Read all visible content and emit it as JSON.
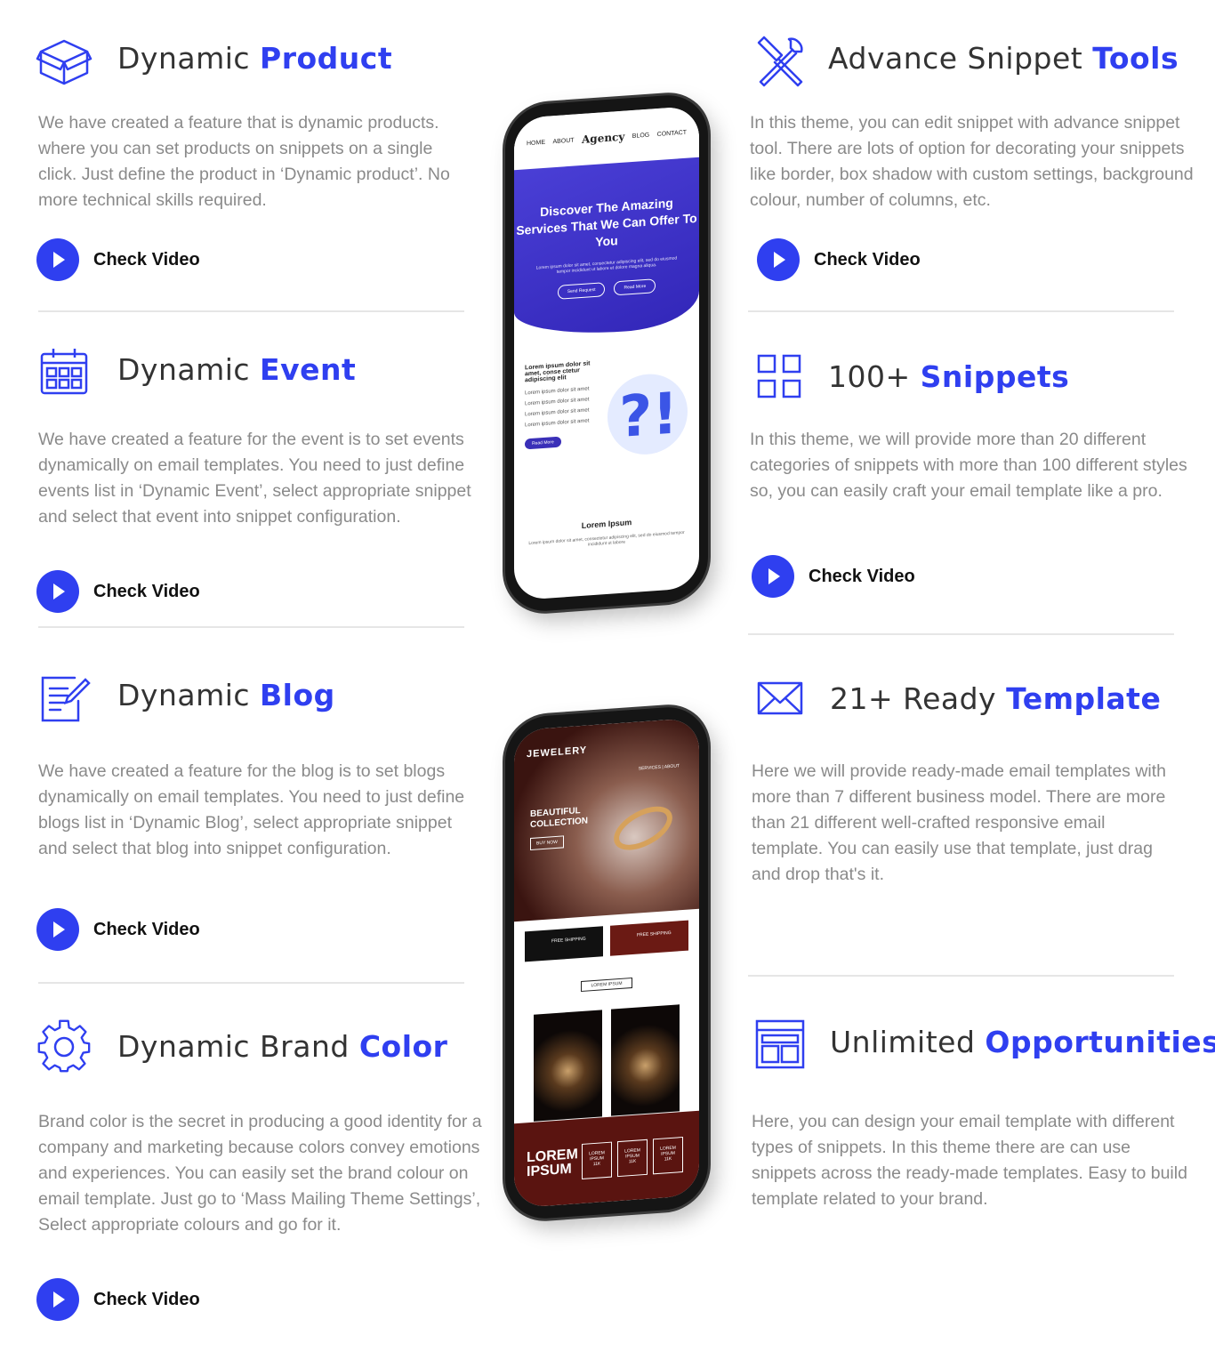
{
  "features": {
    "dynamic_product": {
      "title_plain": "Dynamic ",
      "title_highlight": "Product",
      "description": "We have created a feature that is dynamic products. where you can set products on snippets on a single click. Just define the product in ‘Dynamic product’. No more technical skills required.",
      "cta_label": "Check Video",
      "icon": "box-icon"
    },
    "dynamic_event": {
      "title_plain": "Dynamic ",
      "title_highlight": "Event",
      "description": "We have created a feature for the event is to set events dynamically on email templates. You need to just define events list in ‘Dynamic Event’, select appropriate snippet and select that event into snippet configuration.",
      "cta_label": "Check Video",
      "icon": "calendar-icon"
    },
    "dynamic_blog": {
      "title_plain": "Dynamic ",
      "title_highlight": "Blog",
      "description": "We have created a feature for the blog is to set blogs dynamically on email templates. You need to just define blogs list in ‘Dynamic Blog’, select appropriate snippet and select that blog into snippet configuration.",
      "cta_label": "Check Video",
      "icon": "edit-document-icon"
    },
    "dynamic_brand_color": {
      "title_plain": "Dynamic Brand ",
      "title_highlight": "Color",
      "description": "Brand color is the secret in producing a good identity for a company and marketing because colors convey emotions and experiences. You can easily set the brand colour on email template. Just go to ‘Mass Mailing Theme Settings’, Select appropriate colours and go for it.",
      "cta_label": "Check Video",
      "icon": "gear-icon"
    },
    "advance_snippet_tools": {
      "title_plain": "Advance Snippet ",
      "title_highlight": "Tools",
      "description": "In this theme, you can edit snippet with advance snippet tool. There are lots of option for decorating your snippets like border, box shadow with custom settings, background colour, number of columns, etc.",
      "cta_label": "Check Video",
      "icon": "tools-icon"
    },
    "snippets": {
      "title_plain": "100+ ",
      "title_highlight": "Snippets",
      "description": "In this theme, we will provide more than 20 different categories of snippets with more than 100 different styles so, you can easily craft your email template like a pro.",
      "cta_label": "Check Video",
      "icon": "grid-icon"
    },
    "ready_template": {
      "title_plain": "21+ Ready ",
      "title_highlight": "Template",
      "description": "Here we will provide ready-made email templates with more than 7 different business model. There are more than 21 different well-crafted responsive email template. You can easily use that template, just drag and drop that's it.",
      "icon": "envelope-icon"
    },
    "unlimited_opportunities": {
      "title_plain": "Unlimited ",
      "title_highlight": "Opportunities",
      "description": "Here, you can design your email template with different types of snippets. In this theme there are can use snippets across the ready-made templates. Easy to build template related to your brand.",
      "icon": "layout-icon"
    }
  },
  "phone1": {
    "nav_home": "HOME",
    "nav_about": "ABOUT",
    "brand": "Agency",
    "nav_blog": "BLOG",
    "nav_contact": "CONTACT",
    "hero_title": "Discover The Amazing Services That We Can Offer To You",
    "hero_text": "Lorem ipsum dolor sit amet, consectetur adipiscing elit, sed do eiusmod tempor incididunt ut labore et dolore magna aliqua.",
    "btn_send": "Send Request",
    "btn_read": "Read More",
    "body_title": "Lorem ipsum dolor sit amet, conse ctetur adipiscing elit",
    "body_item": "Lorem ipsum dolor sit amet",
    "read_more": "Read More",
    "section_title": "Lorem Ipsum",
    "section_text": "Lorem ipsum dolor sit amet, consectetur adipiscing elit, sed do eiusmod tempor incididunt ut labore"
  },
  "phone2": {
    "brand": "JEWELERY",
    "nav": "SERVICES | ABOUT",
    "hero_title": "BEAUTIFUL COLLECTION",
    "buy_now": "BUY NOW",
    "ship_a": "FREE SHIPPING",
    "ship_b": "FREE SHIPPING",
    "label": "LOREM IPSUM",
    "product_a": "LOREM IPSUM",
    "product_b": "LOREM IPSUM",
    "footer_big": "LOREM IPSUM",
    "box_label": "LOREM IPSUM",
    "box_value": "11K"
  },
  "colors": {
    "accent": "#2f3ff0",
    "text": "#333333",
    "muted": "#8a8a8a"
  }
}
